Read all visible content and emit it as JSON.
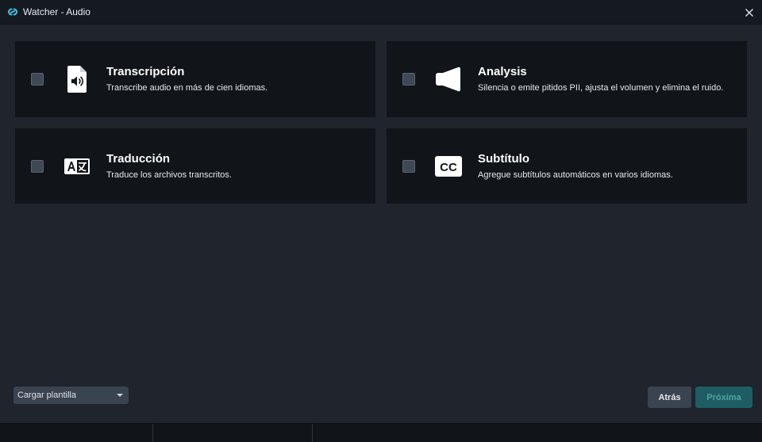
{
  "window": {
    "title": "Watcher - Audio"
  },
  "options": [
    {
      "title": "Transcripción",
      "description": "Transcribe audio en más de cien idiomas.",
      "icon": "audio-file-icon",
      "checked": false
    },
    {
      "title": "Analysis",
      "description": "Silencia o emite pitidos PII, ajusta el volumen y elimina el ruido.",
      "icon": "megaphone-icon",
      "checked": false
    },
    {
      "title": "Traducción",
      "description": "Traduce los archivos transcritos.",
      "icon": "translate-icon",
      "checked": false
    },
    {
      "title": "Subtítulo",
      "description": "Agregue subtítulos automáticos en varios idiomas.",
      "icon": "closed-caption-icon",
      "icon_text": "CC",
      "checked": false
    }
  ],
  "footer": {
    "template_select": "Cargar plantilla",
    "back_label": "Atrás",
    "next_label": "Próxima"
  },
  "colors": {
    "background": "#1f242d",
    "card": "#111418",
    "titlebar": "#151a21",
    "accent": "#1e5d63",
    "accent_text": "#4fa3a6",
    "logo": "#3cc4e6"
  }
}
